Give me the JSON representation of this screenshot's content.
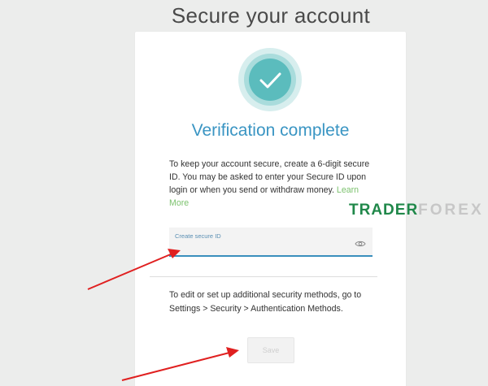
{
  "header": {
    "title": "Secure your account"
  },
  "card": {
    "status_icon": "checkmark-icon",
    "verification_title": "Verification complete",
    "description": "To keep your account secure, create a 6-digit secure ID. You may be asked to enter your Secure ID upon login or when you send or withdraw money.",
    "learn_more": "Learn More",
    "secure_id": {
      "label": "Create secure ID",
      "value": "",
      "toggle_icon": "eye-icon"
    },
    "security_note": "To edit or set up additional security methods, go to Settings > Security > Authentication Methods.",
    "save_label": "Save"
  },
  "watermark": {
    "part1": "TRADER",
    "part2": "FOREX"
  },
  "colors": {
    "accent": "#3a95c3",
    "check": "#5bbcbd",
    "link": "#7cc26e",
    "annotation_arrow": "#e02020"
  }
}
